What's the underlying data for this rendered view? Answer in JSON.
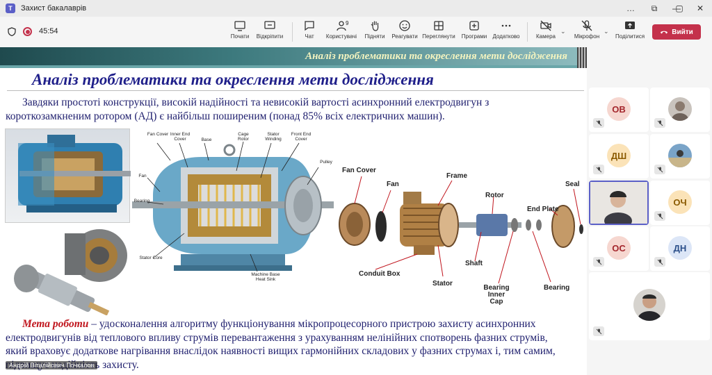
{
  "window": {
    "title": "Захист бакалаврів",
    "controls": [
      "…",
      "⧉",
      "—",
      "▢",
      "✕"
    ]
  },
  "meeting": {
    "timer": "45:54",
    "toolbar": {
      "chat_label": "Чат",
      "people_label": "Користувачі",
      "people_count": "9",
      "raise_label": "Підняти",
      "react_label": "Реагувати",
      "view_label": "Переглянути",
      "apps_label": "Програми",
      "more_label": "Додатково",
      "camera_label": "Камера",
      "mic_label": "Мікрофон",
      "share_label": "Поділитися",
      "leave_label": "Вийти"
    },
    "left_tools": {
      "stop_label": "Почати",
      "unpin_label": "Відкріпити"
    }
  },
  "slide": {
    "band_title": "Аналіз проблематики та окреслення мети дослідження",
    "heading": "Аналіз проблематики та окреслення мети дослідження",
    "paragraph1": "Завдяки простоті конструкції, високій надійності та невисокій вартості асинхронний електродвигун з короткозамкненим ротором (АД) є найбільш поширеним (понад 85% всіх електричних машин).",
    "goal_label": "Мета роботи",
    "paragraph2": " – удосконалення алгоритму функціонування мікропроцесорного пристрою захисту асинхронних електродвигунів від теплового впливу струмів перевантаження з урахуванням нелінійних спотворень фазних струмів, який враховує додаткове нагрівання внаслідок наявності вищих гармонійних складових у фазних струмах і, тим самим, підвищує надійність захисту.",
    "diagram_labels": {
      "fan_cover": "Fan Cover",
      "inner_end_cover": "Inner End Cover",
      "base": "Base",
      "cage_rotor": "Cage Rotor",
      "stator_winding": "Stator Winding",
      "front_end_cover": "Front End Cover",
      "pulley": "Pulley",
      "fan": "Fan",
      "bearing": "Bearing",
      "stator_core": "Stator Core",
      "machine_base": "Machine Base Heat Sink"
    },
    "exploded_labels": {
      "fan_cover": "Fan Cover",
      "fan": "Fan",
      "frame": "Frame",
      "rotor": "Rotor",
      "seal": "Seal",
      "end_plate": "End Plate",
      "shaft": "Shaft",
      "conduit_box": "Conduit Box",
      "stator": "Stator",
      "bearing_inner_cap": "Bearing Inner Cap",
      "bearing": "Bearing"
    },
    "presenter_name": "Андрій Віталійович Почкалов"
  },
  "participants": [
    {
      "initials": "ОВ",
      "color": "#f6d7d0",
      "text_color": "#a4262c"
    },
    {
      "initials": "",
      "type": "photo"
    },
    {
      "initials": "ДШ",
      "color": "#fbe3b8",
      "text_color": "#8a5a00"
    },
    {
      "initials": "",
      "type": "photo"
    },
    {
      "initials": "",
      "type": "video"
    },
    {
      "initials": "ОЧ",
      "color": "#fbe3b8",
      "text_color": "#8a5a00"
    },
    {
      "initials": "ОС",
      "color": "#f6d7d0",
      "text_color": "#a4262c"
    },
    {
      "initials": "ДН",
      "color": "#dce6f7",
      "text_color": "#2b4f8a"
    },
    {
      "initials": "",
      "type": "photo"
    }
  ]
}
